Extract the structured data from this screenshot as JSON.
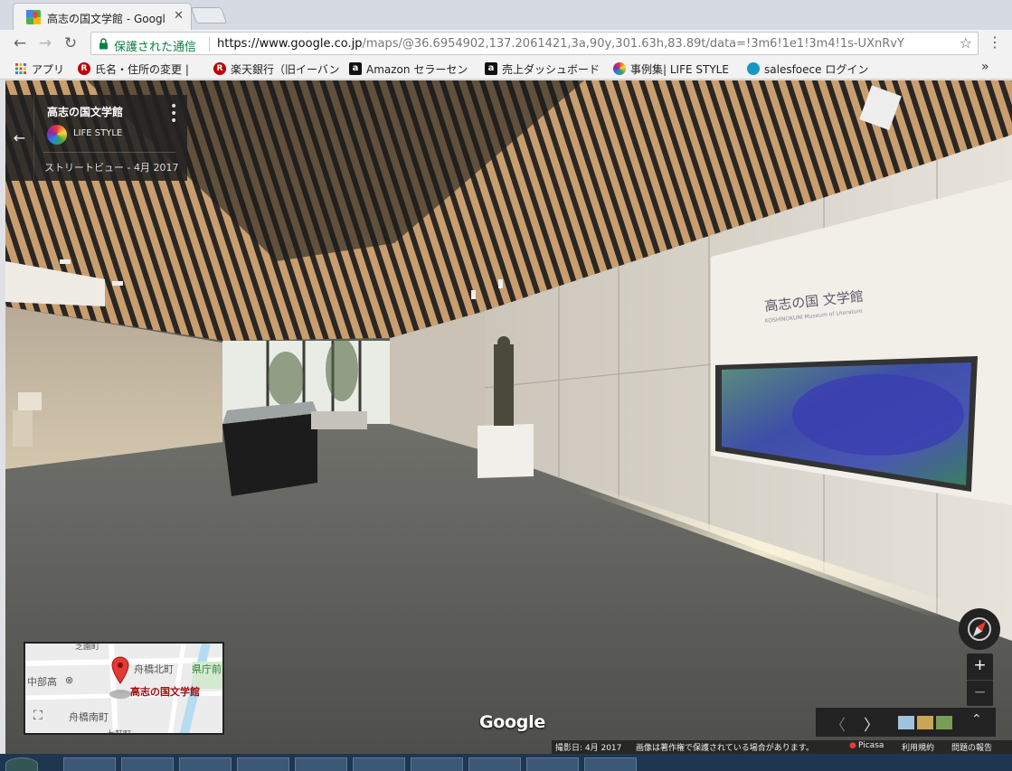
{
  "browser": {
    "tab_title": "高志の国文学館 - Googl",
    "secure_label": "保護された通信",
    "url_host": "https://www.google.co.jp",
    "url_path": "/maps/@36.6954902,137.2061421,3a,90y,301.63h,83.89t/data=!3m6!1e1!3m4!1s-UXnRvY"
  },
  "bookmarks": [
    {
      "label": "アプリ",
      "icon": "apps-grid-icon"
    },
    {
      "label": "氏名・住所の変更 | ",
      "icon": "rakuten-icon"
    },
    {
      "label": "楽天銀行（旧イーバン",
      "icon": "rakuten-icon"
    },
    {
      "label": "Amazon セラーセン",
      "icon": "amazon-icon"
    },
    {
      "label": "売上ダッシュボード",
      "icon": "amazon-icon"
    },
    {
      "label": "事例集| LIFE STYLE",
      "icon": "lifestyle-icon"
    },
    {
      "label": "salesfoece ログイン",
      "icon": "salesforce-icon"
    }
  ],
  "infocard": {
    "title": "高志の国文学館",
    "brand": "LIFE STYLE",
    "date": "ストリートビュー - 4月 2017"
  },
  "scene": {
    "wall_sign_title": "高志の国 文学館",
    "wall_sign_subtitle": "KOSHINOKUNI Museum of Literature"
  },
  "minimap": {
    "place_label": "高志の国文学館",
    "labels": [
      "中部高",
      "舟橋北町",
      "県庁前",
      "舟橋南町",
      "七軒町",
      "芝園町"
    ]
  },
  "google_logo": "Google",
  "zoom": {
    "in": "+",
    "out": "−"
  },
  "footer": {
    "date": "撮影日: 4月 2017",
    "copyright": "画像は著作権で保護されている場合があります。",
    "picasa": "Picasa",
    "terms": "利用規約",
    "report": "問題の報告"
  }
}
